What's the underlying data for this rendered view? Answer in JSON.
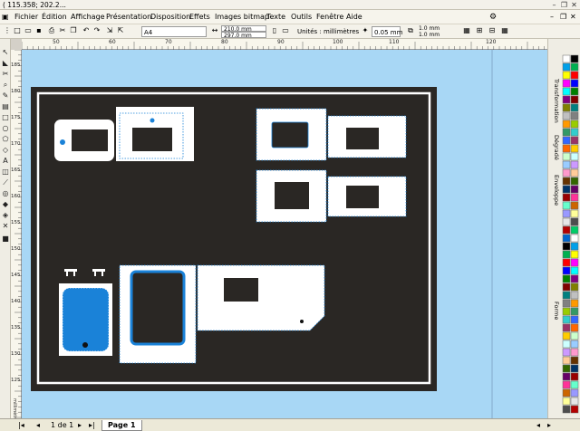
{
  "window": {
    "title": "( 115.358; 202.2..."
  },
  "menu": [
    "Fichier",
    "Édition",
    "Affichage",
    "Présentation",
    "Disposition",
    "Effets",
    "Images bitmap",
    "Texte",
    "Outils",
    "Fenêtre",
    "Aide"
  ],
  "property_bar": {
    "page_size": "A4",
    "width": "210.0 mm",
    "height": "297.0 mm",
    "units": "Unités : millimètres",
    "nudge": "0.05 mm",
    "dup_x": "1.0 mm",
    "dup_y": "1.0 mm"
  },
  "ruler": {
    "h_labels": [
      "50",
      "60",
      "70",
      "80",
      "90",
      "100",
      "110",
      "120"
    ],
    "v_labels": [
      "185",
      "180",
      "175",
      "170",
      "165",
      "160",
      "155",
      "150",
      "145",
      "140",
      "135",
      "130",
      "125"
    ],
    "v_unit": "millimètres"
  },
  "right_tabs": [
    "Transformation",
    "Dégradé",
    "Enveloppe",
    "Forme"
  ],
  "status": {
    "page_count": "1 de 1",
    "page_tab": "Page 1"
  },
  "colors": {
    "canvas": "#a8d7f5",
    "board": "#2a2724",
    "accent": "#1a82d8"
  }
}
